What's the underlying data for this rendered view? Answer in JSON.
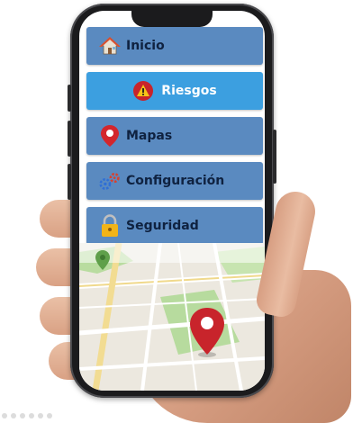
{
  "menu": {
    "items": [
      {
        "label": "Inicio",
        "icon": "home-icon",
        "active": false
      },
      {
        "label": "Riesgos",
        "icon": "warning-icon",
        "active": true
      },
      {
        "label": "Mapas",
        "icon": "map-pin-icon",
        "active": false
      },
      {
        "label": "Configuración",
        "icon": "settings-gears-icon",
        "active": false
      },
      {
        "label": "Seguridad",
        "icon": "lock-icon",
        "active": false
      }
    ]
  },
  "colors": {
    "menu_item": "#5a8ac0",
    "menu_item_active": "#3c9fe0",
    "label_text": "#0f2240",
    "pin_red": "#c8242b"
  }
}
